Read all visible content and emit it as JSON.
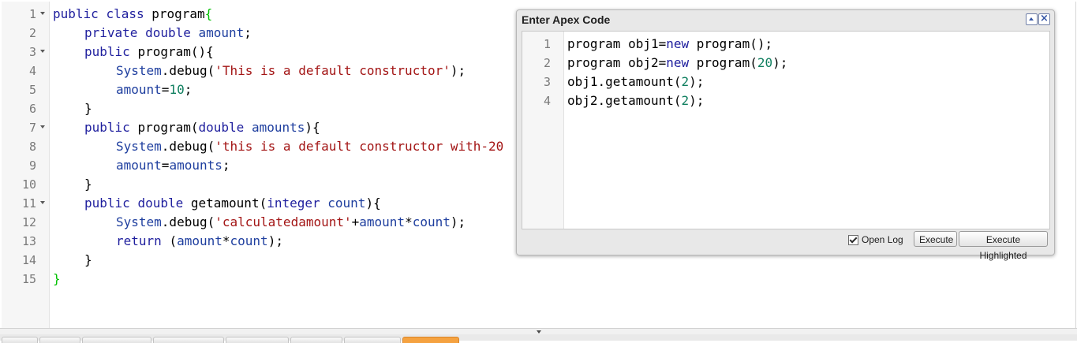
{
  "editor": {
    "lines": [
      {
        "n": "1",
        "fold": true,
        "indent": 0,
        "tokens": [
          [
            "kw",
            "public "
          ],
          [
            "kw",
            "class "
          ],
          [
            "",
            "program"
          ],
          [
            "brg",
            "{"
          ]
        ]
      },
      {
        "n": "2",
        "fold": false,
        "indent": 1,
        "tokens": [
          [
            "kw",
            "private "
          ],
          [
            "kw",
            "double "
          ],
          [
            "var",
            "amount"
          ],
          [
            "",
            ";"
          ]
        ]
      },
      {
        "n": "3",
        "fold": true,
        "indent": 1,
        "tokens": [
          [
            "kw",
            "public "
          ],
          [
            "",
            "program(){"
          ]
        ]
      },
      {
        "n": "4",
        "fold": false,
        "indent": 2,
        "tokens": [
          [
            "var",
            "System"
          ],
          [
            "",
            ".debug("
          ],
          [
            "str",
            "'This is a default constructor'"
          ],
          [
            "",
            ");"
          ]
        ]
      },
      {
        "n": "5",
        "fold": false,
        "indent": 2,
        "tokens": [
          [
            "var",
            "amount"
          ],
          [
            "",
            "="
          ],
          [
            "num",
            "10"
          ],
          [
            "",
            ";"
          ]
        ]
      },
      {
        "n": "6",
        "fold": false,
        "indent": 1,
        "tokens": [
          [
            "",
            "}"
          ]
        ]
      },
      {
        "n": "7",
        "fold": true,
        "indent": 1,
        "tokens": [
          [
            "kw",
            "public "
          ],
          [
            "",
            "program("
          ],
          [
            "kw",
            "double "
          ],
          [
            "var",
            "amounts"
          ],
          [
            "",
            "){"
          ]
        ]
      },
      {
        "n": "8",
        "fold": false,
        "indent": 2,
        "tokens": [
          [
            "var",
            "System"
          ],
          [
            "",
            ".debug("
          ],
          [
            "str",
            "'this is a default constructor with-20"
          ]
        ]
      },
      {
        "n": "9",
        "fold": false,
        "indent": 2,
        "tokens": [
          [
            "var",
            "amount"
          ],
          [
            "",
            "="
          ],
          [
            "var",
            "amounts"
          ],
          [
            "",
            ";"
          ]
        ]
      },
      {
        "n": "10",
        "fold": false,
        "indent": 1,
        "tokens": [
          [
            "",
            "}"
          ]
        ]
      },
      {
        "n": "11",
        "fold": true,
        "indent": 1,
        "tokens": [
          [
            "kw",
            "public "
          ],
          [
            "kw",
            "double "
          ],
          [
            "",
            "getamount("
          ],
          [
            "kw",
            "integer "
          ],
          [
            "var",
            "count"
          ],
          [
            "",
            "){"
          ]
        ]
      },
      {
        "n": "12",
        "fold": false,
        "indent": 2,
        "tokens": [
          [
            "var",
            "System"
          ],
          [
            "",
            ".debug("
          ],
          [
            "str",
            "'calculatedamount'"
          ],
          [
            "",
            "+"
          ],
          [
            "var",
            "amount"
          ],
          [
            "",
            "*"
          ],
          [
            "var",
            "count"
          ],
          [
            "",
            ");"
          ]
        ]
      },
      {
        "n": "13",
        "fold": false,
        "indent": 2,
        "tokens": [
          [
            "kw",
            "return "
          ],
          [
            "",
            "("
          ],
          [
            "var",
            "amount"
          ],
          [
            "",
            "*"
          ],
          [
            "var",
            "count"
          ],
          [
            "",
            ");"
          ]
        ]
      },
      {
        "n": "14",
        "fold": false,
        "indent": 1,
        "tokens": [
          [
            "",
            "}"
          ]
        ]
      },
      {
        "n": "15",
        "fold": false,
        "indent": 0,
        "tokens": [
          [
            "brg",
            "}"
          ]
        ]
      }
    ]
  },
  "dialog": {
    "title": "Enter Apex Code",
    "lines": [
      {
        "n": "1",
        "tokens": [
          [
            "",
            "program obj1="
          ],
          [
            "kw",
            "new "
          ],
          [
            "",
            "program();"
          ]
        ]
      },
      {
        "n": "2",
        "tokens": [
          [
            "",
            "program obj2="
          ],
          [
            "kw",
            "new "
          ],
          [
            "",
            "program("
          ],
          [
            "num",
            "20"
          ],
          [
            "",
            ");"
          ]
        ]
      },
      {
        "n": "3",
        "tokens": [
          [
            "",
            "obj1.getamount("
          ],
          [
            "num",
            "2"
          ],
          [
            "",
            ");"
          ]
        ]
      },
      {
        "n": "4",
        "tokens": [
          [
            "",
            "obj2.getamount("
          ],
          [
            "num",
            "2"
          ],
          [
            "",
            ");"
          ]
        ]
      }
    ],
    "open_log_label": "Open Log",
    "open_log_checked": true,
    "execute_label": "Execute",
    "execute_highlighted_label": "Execute Highlighted"
  },
  "colors": {
    "keyword": "#1f1f9e",
    "string": "#a31515",
    "number": "#0f7f5f",
    "bracket": "#00c000",
    "active_tab": "#f5a240"
  },
  "tabs": [
    "",
    "",
    "",
    "",
    "",
    "",
    "",
    ""
  ],
  "active_tab_index": 7
}
